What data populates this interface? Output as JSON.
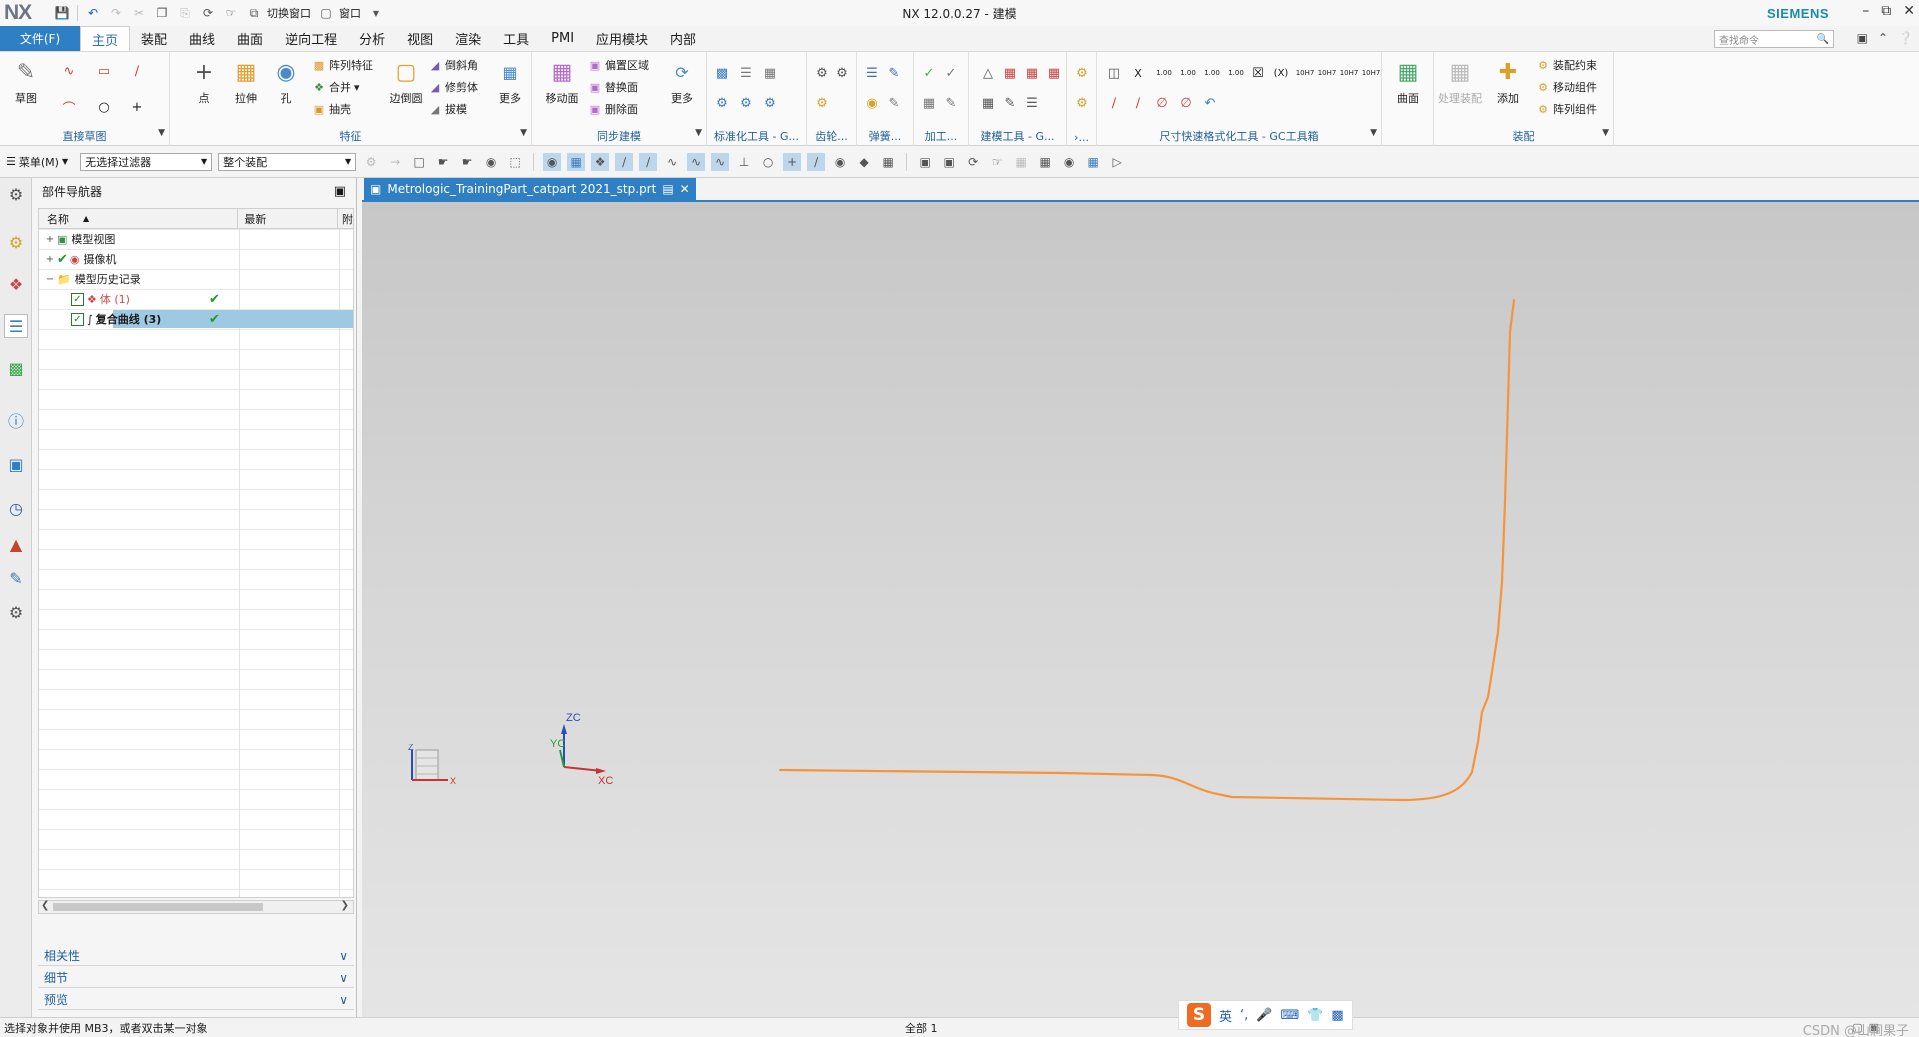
{
  "titlebar": {
    "app_logo": "NX",
    "title": "NX 12.0.0.27 - 建模",
    "switch_window": "切换窗口",
    "window_menu": "窗口",
    "brand": "SIEMENS"
  },
  "menubar": {
    "file": "文件(F)",
    "tabs": [
      "主页",
      "装配",
      "曲线",
      "曲面",
      "逆向工程",
      "分析",
      "视图",
      "渲染",
      "工具",
      "PMI",
      "应用模块",
      "内部"
    ],
    "active_tab": "主页",
    "search_placeholder": "查找命令"
  },
  "ribbon": {
    "sketch": {
      "label": "草图",
      "group": "直接草图"
    },
    "feature": {
      "group": "特征",
      "point": "点",
      "extrude": "拉伸",
      "hole": "孔",
      "pattern": "阵列特征",
      "unite": "合并",
      "shell": "抽壳",
      "edge_blend": "边倒圆",
      "chamfer": "倒斜角",
      "trim_body": "修剪体",
      "draft": "拔模",
      "more": "更多"
    },
    "sync": {
      "group": "同步建模",
      "move_face": "移动面",
      "offset_region": "偏置区域",
      "replace_face": "替换面",
      "delete_face": "删除面",
      "more": "更多"
    },
    "groups_small": [
      "标准化工具 - G...",
      "齿轮...",
      "弹簧...",
      "加工...",
      "建模工具 - G...",
      "›..."
    ],
    "dim_tools": "尺寸快速格式化工具 - GC工具箱",
    "dim_texts": [
      "X",
      "1.00",
      "1.00",
      "1.00",
      "1.00",
      "(X)",
      "10H7",
      "10H7",
      "10H7",
      "10H7"
    ],
    "surface": {
      "label": "曲面"
    },
    "assembly": {
      "group": "装配",
      "process_asm": "处理装配",
      "add": "添加",
      "constraints": "装配约束",
      "move_component": "移动组件",
      "pattern_component": "阵列组件"
    }
  },
  "selbar": {
    "menu": "菜单(M)",
    "filter": "无选择过滤器",
    "scope": "整个装配"
  },
  "navigator": {
    "title": "部件导航器",
    "col_name": "名称",
    "col_latest": "最新",
    "col_extra": "附",
    "rows": [
      {
        "label": "模型视图"
      },
      {
        "label": "摄像机"
      },
      {
        "label": "模型历史记录"
      },
      {
        "label": "体 (1)"
      },
      {
        "label": "复合曲线 (3)"
      }
    ],
    "panels": [
      "相关性",
      "细节",
      "预览"
    ]
  },
  "document": {
    "tab_title": "Metrologic_TrainingPart_catpart 2021_stp.prt"
  },
  "viewport": {
    "wcs_labels": {
      "zc": "ZC",
      "yc": "YC",
      "xc": "XC"
    },
    "triad_labels": {
      "z": "Z",
      "x": "X"
    },
    "curve_color": "#f5943a"
  },
  "status": {
    "message": "选择对象并使用 MB3，或者双击某一对象",
    "selection": "全部 1",
    "ime_lang": "英",
    "watermark": "CSDN @山涧果子"
  }
}
